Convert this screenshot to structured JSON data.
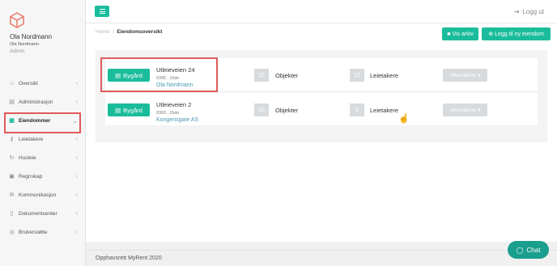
{
  "user": {
    "name": "Ola Nordmann",
    "sub": "Ola Nordmann",
    "role": "Admin"
  },
  "nav": {
    "items": [
      {
        "label": "Oversikt",
        "icon": "home-icon",
        "glyph": "⌂"
      },
      {
        "label": "Administrasjon",
        "icon": "briefcase-icon",
        "glyph": "▤"
      },
      {
        "label": "Eiendommer",
        "icon": "building-icon",
        "glyph": "▦"
      },
      {
        "label": "Leietakere",
        "icon": "key-icon",
        "glyph": "⚷"
      },
      {
        "label": "Husleie",
        "icon": "refresh-icon",
        "glyph": "↻"
      },
      {
        "label": "Regnskap",
        "icon": "calculator-icon",
        "glyph": "▣"
      },
      {
        "label": "Kommunikasjon",
        "icon": "chat-bubbles-icon",
        "glyph": "✉"
      },
      {
        "label": "Dokumentsenter",
        "icon": "document-icon",
        "glyph": "▯"
      },
      {
        "label": "Brukerstøtte",
        "icon": "lifebuoy-icon",
        "glyph": "◎"
      }
    ]
  },
  "topbar": {
    "logout_label": "Logg ut"
  },
  "breadcrumb": {
    "home": "Home",
    "separator": "/",
    "current": "Eiendomsoversikt"
  },
  "toolbar": {
    "archive_label": "Vis arkiv",
    "add_label": "Legg til ny eiendom"
  },
  "properties": [
    {
      "type_label": "Bygård",
      "street": "Utleieveien 24",
      "postal": "0395 , Oslo",
      "owner": "Ola Nordmann",
      "objects_count": "10",
      "objects_label": "Objekter",
      "tenants_count": "12",
      "tenants_label": "Leietakere",
      "alt_label": "Alternativer ▾"
    },
    {
      "type_label": "Bygård",
      "street": "Utleieveien 2",
      "postal": "0362 , Oslo",
      "owner": "Kongensgate AS",
      "objects_count": "10",
      "objects_label": "Objekter",
      "tenants_count": "0",
      "tenants_label": "Leietakere",
      "alt_label": "Alternativer ▾"
    }
  ],
  "footer": {
    "copyright": "Opphavsrett MyRent 2020"
  },
  "chat": {
    "label": "Chat"
  },
  "colors": {
    "accent": "#1abc9c",
    "highlight": "#e05a5a",
    "link": "#4a9ab5"
  }
}
